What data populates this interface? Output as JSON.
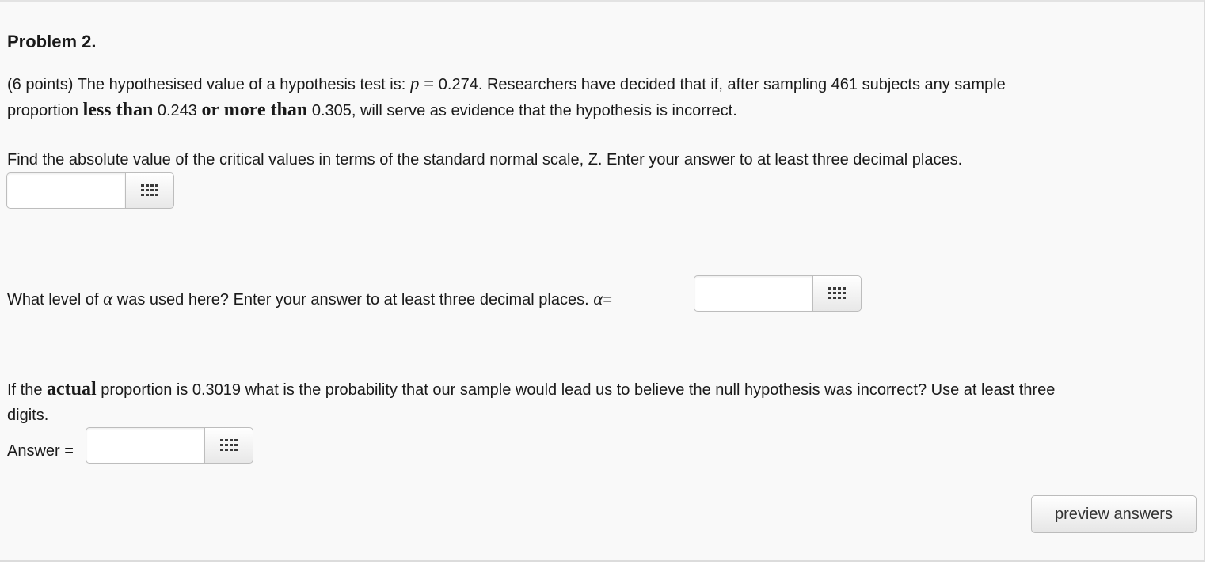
{
  "problem": {
    "title": "Problem 2.",
    "intro": {
      "before_p": "(6 points) The hypothesised value of a hypothesis test is: ",
      "p_symbol": "p",
      "equals": " = ",
      "p_value": "0.274",
      "after_p": ". Researchers have decided that if, after sampling 461 subjects any sample",
      "line2_start": "proportion ",
      "less_than": "less than",
      "lower": " 0.243 ",
      "or_more_than": "or more than",
      "upper_rest": " 0.305, will serve as evidence that the hypothesis is incorrect."
    }
  },
  "q1": {
    "text": "Find the absolute value of the critical values in terms of the standard normal scale, Z. Enter your answer to at least three decimal places.",
    "value": ""
  },
  "q2": {
    "text_before": "What level of ",
    "alpha": "α",
    "text_after": " was used here? Enter your answer to at least three decimal places. ",
    "alpha_label": "α",
    "equals": "=",
    "value": ""
  },
  "q3": {
    "text_start": "If the ",
    "actual": "actual",
    "text_line1": " proportion is 0.3019 what is the probability that our sample would lead us to believe the null hypothesis was incorrect? Use at least three",
    "text_line2": "digits.",
    "answer_label": "Answer =",
    "value": ""
  },
  "icons": {
    "palette": "grid-palette-icon"
  },
  "buttons": {
    "preview": "preview answers"
  }
}
